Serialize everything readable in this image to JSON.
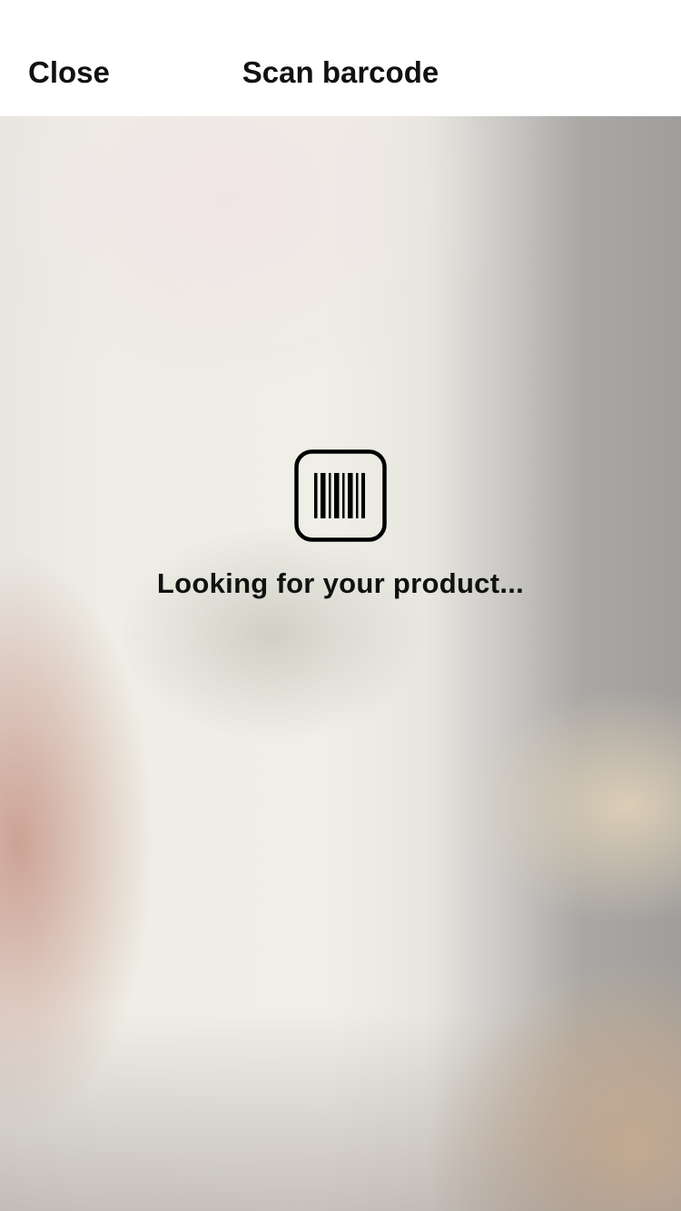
{
  "navbar": {
    "close_label": "Close",
    "title": "Scan barcode"
  },
  "scanner": {
    "icon": "barcode-icon",
    "status": "Looking for your product..."
  }
}
